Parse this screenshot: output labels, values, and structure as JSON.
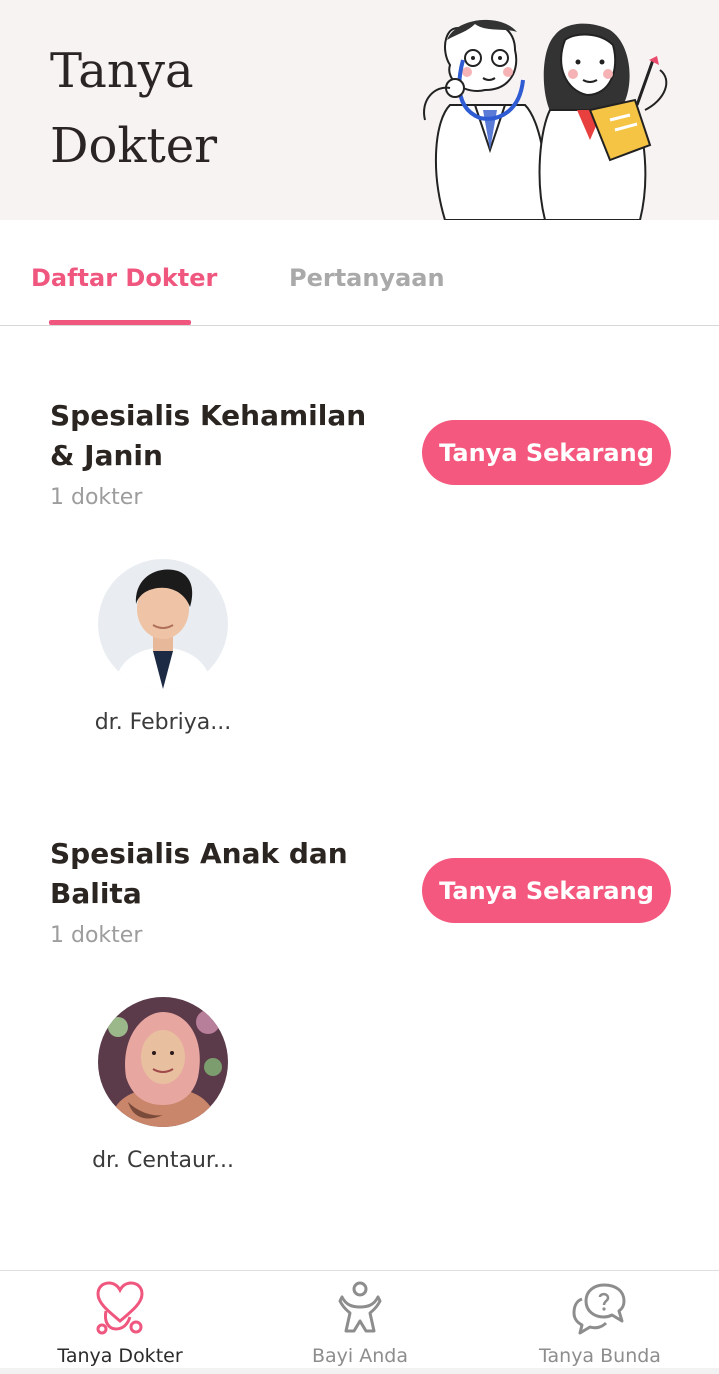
{
  "header": {
    "title_line1": "Tanya",
    "title_line2": "Dokter",
    "illustration_icon": "two-doctors-illustration"
  },
  "tabs": [
    {
      "label": "Daftar Dokter",
      "active": true
    },
    {
      "label": "Pertanyaan",
      "active": false
    }
  ],
  "sections": [
    {
      "title": "Spesialis Kehamilan & Janin",
      "count": "1 dokter",
      "button_label": "Tanya Sekarang",
      "doctor_name": "dr. Febriya..."
    },
    {
      "title": "Spesialis Anak dan Balita",
      "count": "1 dokter",
      "button_label": "Tanya Sekarang",
      "doctor_name": "dr. Centaur..."
    }
  ],
  "bottom_nav": [
    {
      "label": "Tanya Dokter",
      "icon": "heart-stethoscope-icon",
      "active": true
    },
    {
      "label": "Bayi Anda",
      "icon": "baby-icon",
      "active": false
    },
    {
      "label": "Tanya Bunda",
      "icon": "chat-bubbles-icon",
      "active": false
    }
  ],
  "colors": {
    "accent": "#f5587e",
    "tab_active": "#f0577f",
    "header_bg": "#f7f3f2",
    "muted_text": "#9d9d9d"
  }
}
